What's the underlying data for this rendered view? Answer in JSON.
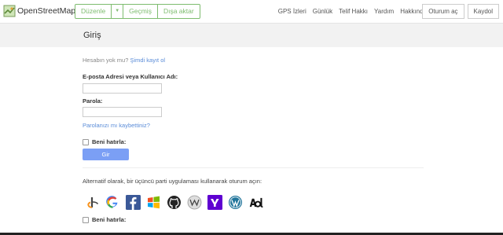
{
  "header": {
    "brand": "OpenStreetMap",
    "edit": "Düzenle",
    "history": "Geçmiş",
    "export": "Dışa aktar",
    "nav": [
      "GPS İzleri",
      "Günlük",
      "Telif Hakkı",
      "Yardım",
      "Hakkında"
    ],
    "login": "Oturum aç",
    "signup": "Kaydol"
  },
  "page": {
    "title": "Giriş"
  },
  "form": {
    "no_account": "Hesabın yok mu?",
    "register_now": "Şimdi kayıt ol",
    "username_label": "E-posta Adresi veya Kullanıcı Adı:",
    "username_value": "",
    "password_label": "Parola:",
    "password_value": "",
    "forgot": "Parolanızı mı kaybettiniz?",
    "remember": "Beni hatırla:",
    "submit": "Gir"
  },
  "alt": {
    "text": "Alternatif olarak, bir üçüncü parti uygulaması kullanarak oturum açın:",
    "providers": [
      "openid-icon",
      "google-icon",
      "facebook-icon",
      "windowslive-icon",
      "github-icon",
      "wikipedia-icon",
      "yahoo-icon",
      "wordpress-icon",
      "aol-icon"
    ],
    "remember": "Beni hatırla:"
  },
  "colors": {
    "accent": "#7ebc6f",
    "link": "#5a8cd8",
    "button": "#7b9ff5"
  }
}
